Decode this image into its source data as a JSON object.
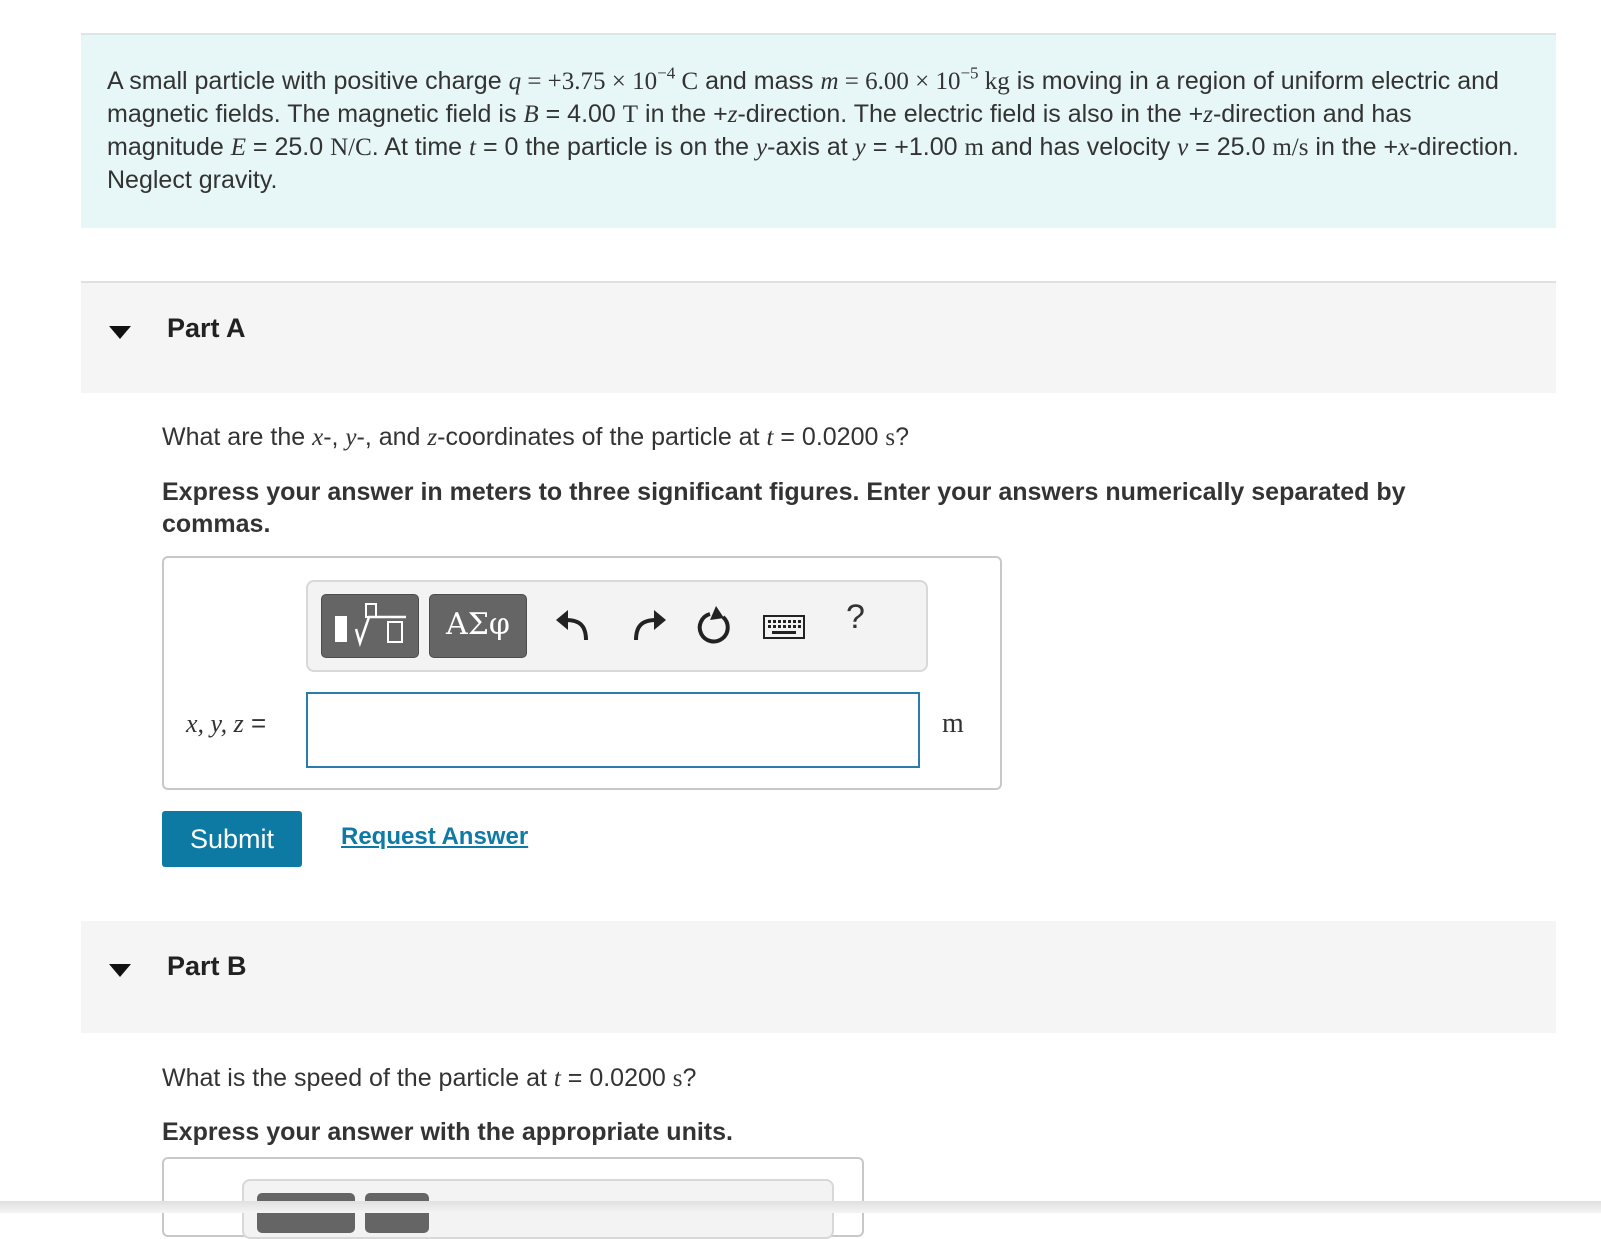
{
  "intro": {
    "t01": "A small particle with positive charge ",
    "t02": "q",
    "t03": " = +3.75 × 10",
    "t04": "−4",
    "t05": " C",
    "t06": " and mass ",
    "t07": "m",
    "t08": " = 6.00 × 10",
    "t09": "−5",
    "t10": " kg",
    "t11": " is moving in a region of uniform electric and magnetic fields. The magnetic field is ",
    "t12": "B",
    "t13": " = 4.00 ",
    "t14": "T",
    "t15": " in the +",
    "t16": "z",
    "t17": "-direction. The electric field is also in the +",
    "t18": "z",
    "t19": "-direction and has magnitude ",
    "t20": "E",
    "t21": " = 25.0 ",
    "t22": "N/C",
    "t23": ". At time ",
    "t24": "t",
    "t25": " = 0 the particle is on the ",
    "t26": "y",
    "t27": "-axis at ",
    "t28": "y",
    "t29": " = +1.00 ",
    "t30": "m",
    "t31": " and has velocity ",
    "t32": "v",
    "t33": " = 25.0 ",
    "t34": "m/s",
    "t35": " in the +",
    "t36": "x",
    "t37": "-direction. Neglect gravity."
  },
  "partA": {
    "title": "Part A",
    "q1": "What are the ",
    "q2": "x",
    "q3": "-, ",
    "q4": "y",
    "q5": "-, and ",
    "q6": "z",
    "q7": "-coordinates of the particle at ",
    "q8": "t",
    "q9": " = 0.0200 ",
    "q10": "s",
    "q11": "?",
    "instruction": "Express your answer in meters to three significant figures. Enter your answers numerically separated by commas.",
    "label_vars": "x, y, z",
    "label_eq": " =",
    "input_value": "",
    "unit": "m",
    "toolbar": {
      "templates_icon": "templates-icon",
      "symbols_label": "ΑΣφ",
      "undo_icon": "undo-icon",
      "redo_icon": "redo-icon",
      "reset_icon": "reset-icon",
      "keyboard_icon": "keyboard-icon",
      "help_label": "?"
    },
    "submit_label": "Submit",
    "request_answer_label": "Request Answer"
  },
  "partB": {
    "title": "Part B",
    "q1": "What is the speed of the particle at ",
    "q2": "t",
    "q3": " = 0.0200 ",
    "q4": "s",
    "q5": "?",
    "instruction": "Express your answer with the appropriate units."
  },
  "colors": {
    "intro_bg": "#e7f6f6",
    "accent": "#0d7aa3",
    "input_border": "#2a7dab",
    "toolbar_button": "#656565"
  }
}
